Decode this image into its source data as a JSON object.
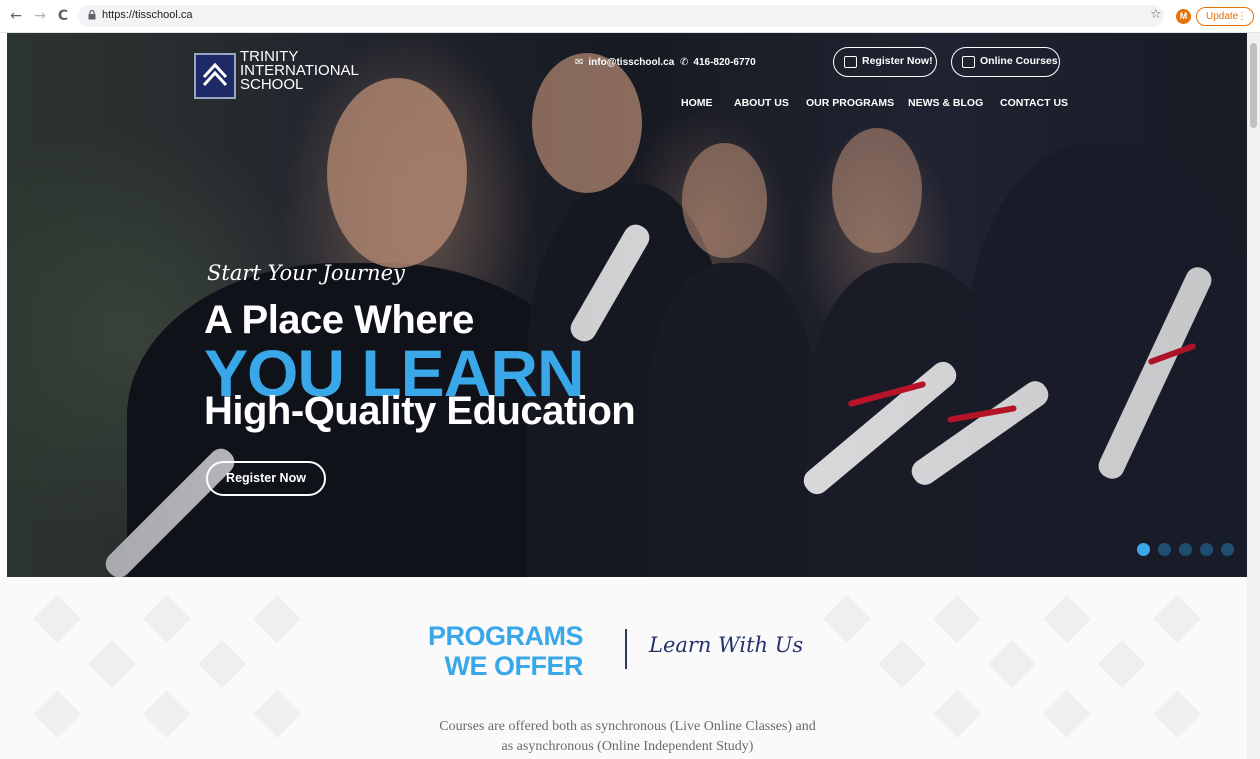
{
  "browser": {
    "url": "https://tisschool.ca",
    "profile_initial": "M",
    "update_label": "Update",
    "update_menu": "⋮",
    "back_icon": "←",
    "forward_icon": "→",
    "reload_icon": "C",
    "star_icon": "☆",
    "accent_color": "#e8710a"
  },
  "header": {
    "logo_lines": [
      "TRINITY",
      "INTERNATIONAL",
      "SCHOOL"
    ],
    "email": "info@tisschool.ca",
    "phone": "416-820-6770",
    "register_button": "Register Now!",
    "online_courses_button": "Online Courses",
    "menu": [
      "HOME",
      "ABOUT US",
      "OUR PROGRAMS",
      "NEWS & BLOG",
      "CONTACT US"
    ]
  },
  "hero": {
    "script": "Start Your Journey",
    "line1": "A Place Where",
    "line2": "YOU LEARN",
    "line3": "High-Quality Education",
    "cta": "Register Now",
    "accent_color": "#3aa8e8",
    "slides_total": 5,
    "active_slide": 1
  },
  "programs": {
    "title_line1": "PROGRAMS",
    "title_line2": "WE OFFER",
    "script": "Learn With Us",
    "description_line1": "Courses are offered both as synchronous (Live Online Classes) and",
    "description_line2": "as asynchronous (Online Independent Study)"
  }
}
